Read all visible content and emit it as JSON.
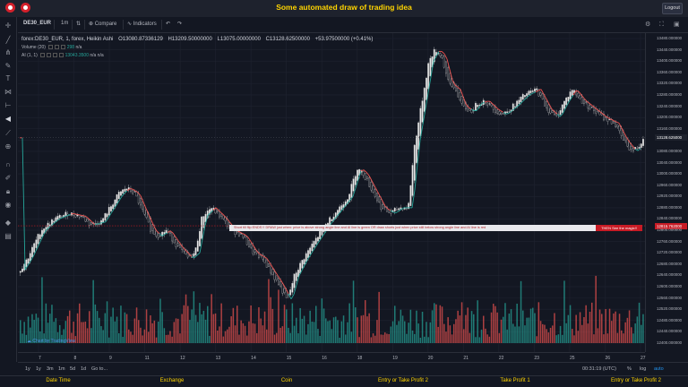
{
  "header": {
    "title": "Some automated draw of trading idea",
    "logout_label": "Logout"
  },
  "toolbar": {
    "symbol": "DE30_EUR",
    "interval": "1m",
    "compare_label": "Compare",
    "indicators_label": "Indicators"
  },
  "legend": {
    "series_name": "forex:DE30_EUR, 1, forex, Heikin Ashi",
    "open": "O13080.87336129",
    "high": "H13209.50000000",
    "low": "L13075.00000000",
    "close": "C13128.62500000",
    "change": "+53.97500000 (+0.41%)",
    "volume_label": "Volume (20)",
    "volume_value": "298",
    "volume_ma": "n/a",
    "ai_label": "AI (1, 1)",
    "ai_value": "13043.3500",
    "ai_na1": "n/a",
    "ai_na2": "n/a"
  },
  "banner": {
    "text": "Short till flip ENDS !!    DRAW just when:  price is above strong angle line and AI line is green        OR        draw shorts just when price still below strong angle line and AI line is red",
    "tag": "THEN See the magic!!"
  },
  "attribution": "Chart by TradingView",
  "y_axis": {
    "labels": [
      "13480.000000",
      "13440.000000",
      "13400.000000",
      "13360.000000",
      "13320.000000",
      "13280.000000",
      "13240.000000",
      "13200.000000",
      "13160.000000",
      "13128.625000",
      "13080.000000",
      "13040.000000",
      "13000.000000",
      "12960.000000",
      "12920.000000",
      "12880.000000",
      "12840.000000",
      "12815.762000",
      "12800.000000",
      "12760.000000",
      "12720.000000",
      "12680.000000",
      "12640.000000",
      "12600.000000",
      "12560.000000",
      "12520.000000",
      "12480.000000",
      "12440.000000",
      "12400.000000"
    ],
    "last_price": "13128.625000",
    "marker_price": "12815.762000",
    "marker_color": "#c81b25",
    "last_color": "#1e222d"
  },
  "x_axis": {
    "labels": [
      "7",
      "8",
      "9",
      "11",
      "12",
      "13",
      "14",
      "15",
      "16",
      "18",
      "19",
      "20",
      "21",
      "22",
      "23",
      "25",
      "26",
      "27"
    ]
  },
  "bottom": {
    "ranges": [
      "1y",
      "1y",
      "3m",
      "1m",
      "5d",
      "1d",
      "Go to..."
    ],
    "time": "00:31:19 (UTC)",
    "pct": "%",
    "log": "log",
    "auto": "auto"
  },
  "footer": {
    "columns": [
      "Date Time",
      "Exchange",
      "Coin",
      "Entry or Take Profit 2",
      "Take Profit 1",
      "Entry or Take Profit 2"
    ]
  },
  "chart_data": {
    "type": "candlestick",
    "ylim": [
      12400,
      13480
    ],
    "last_close": 13128.625,
    "dotted_level": 12815.762,
    "colors": {
      "up": "#e8e8e8",
      "down": "#131722",
      "volume_up": "#26a69a",
      "volume_down": "#ef5350",
      "ai_up": "#26a69a",
      "ai_down": "#ef5350"
    },
    "price_path": [
      [
        0,
        12650
      ],
      [
        10,
        12700
      ],
      [
        25,
        12800
      ],
      [
        40,
        12840
      ],
      [
        55,
        12860
      ],
      [
        70,
        12850
      ],
      [
        80,
        12820
      ],
      [
        92,
        12830
      ],
      [
        102,
        12880
      ],
      [
        112,
        12930
      ],
      [
        120,
        12950
      ],
      [
        130,
        12930
      ],
      [
        138,
        12870
      ],
      [
        148,
        12800
      ],
      [
        155,
        12780
      ],
      [
        165,
        12800
      ],
      [
        178,
        12740
      ],
      [
        190,
        12700
      ],
      [
        197,
        12720
      ],
      [
        205,
        12850
      ],
      [
        215,
        12880
      ],
      [
        225,
        12850
      ],
      [
        238,
        12800
      ],
      [
        250,
        12780
      ],
      [
        262,
        12720
      ],
      [
        272,
        12700
      ],
      [
        282,
        12650
      ],
      [
        292,
        12600
      ],
      [
        300,
        12550
      ],
      [
        308,
        12640
      ],
      [
        318,
        12700
      ],
      [
        330,
        12760
      ],
      [
        345,
        12830
      ],
      [
        358,
        12880
      ],
      [
        368,
        12920
      ],
      [
        378,
        13020
      ],
      [
        385,
        13000
      ],
      [
        395,
        12940
      ],
      [
        405,
        12880
      ],
      [
        415,
        12860
      ],
      [
        425,
        12880
      ],
      [
        435,
        12880
      ],
      [
        442,
        13100
      ],
      [
        450,
        13250
      ],
      [
        458,
        13400
      ],
      [
        465,
        13440
      ],
      [
        472,
        13420
      ],
      [
        480,
        13320
      ],
      [
        488,
        13300
      ],
      [
        495,
        13240
      ],
      [
        505,
        13220
      ],
      [
        512,
        13250
      ],
      [
        520,
        13260
      ],
      [
        530,
        13230
      ],
      [
        540,
        13210
      ],
      [
        552,
        13240
      ],
      [
        565,
        13280
      ],
      [
        578,
        13300
      ],
      [
        590,
        13230
      ],
      [
        600,
        13200
      ],
      [
        608,
        13250
      ],
      [
        618,
        13300
      ],
      [
        628,
        13260
      ],
      [
        640,
        13230
      ],
      [
        652,
        13200
      ],
      [
        665,
        13180
      ],
      [
        675,
        13120
      ],
      [
        685,
        13080
      ],
      [
        693,
        13100
      ],
      [
        697,
        13128
      ]
    ]
  }
}
